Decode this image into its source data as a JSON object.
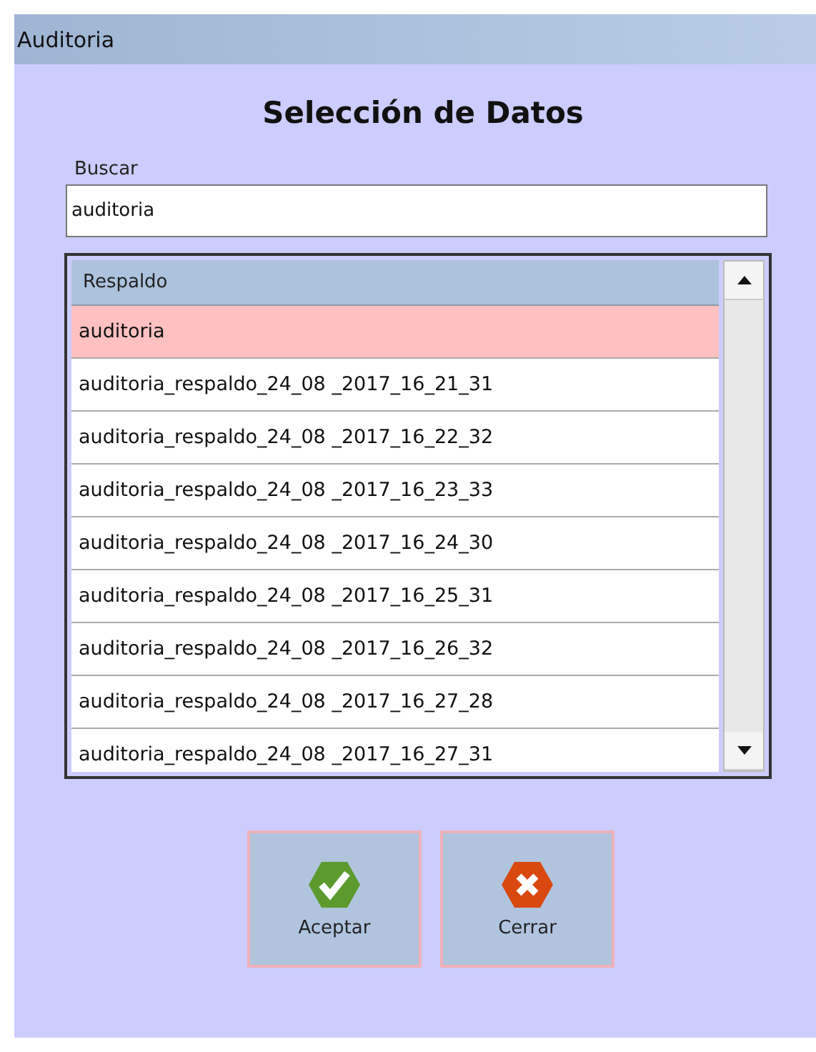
{
  "window": {
    "title": "Auditoria"
  },
  "heading": "Selección de Datos",
  "search": {
    "label": "Buscar",
    "value": "auditoria"
  },
  "table": {
    "columns": [
      "Respaldo"
    ],
    "rows": [
      {
        "cells": [
          "auditoria"
        ],
        "selected": true
      },
      {
        "cells": [
          "auditoria_respaldo_24_08 _2017_16_21_31"
        ],
        "selected": false
      },
      {
        "cells": [
          "auditoria_respaldo_24_08 _2017_16_22_32"
        ],
        "selected": false
      },
      {
        "cells": [
          "auditoria_respaldo_24_08 _2017_16_23_33"
        ],
        "selected": false
      },
      {
        "cells": [
          "auditoria_respaldo_24_08 _2017_16_24_30"
        ],
        "selected": false
      },
      {
        "cells": [
          "auditoria_respaldo_24_08 _2017_16_25_31"
        ],
        "selected": false
      },
      {
        "cells": [
          "auditoria_respaldo_24_08 _2017_16_26_32"
        ],
        "selected": false
      },
      {
        "cells": [
          "auditoria_respaldo_24_08 _2017_16_27_28"
        ],
        "selected": false
      },
      {
        "cells": [
          "auditoria_respaldo_24_08 _2017_16_27_31"
        ],
        "selected": false
      }
    ]
  },
  "buttons": [
    {
      "label": "Aceptar",
      "kind": "accept"
    },
    {
      "label": "Cerrar",
      "kind": "close"
    }
  ]
}
